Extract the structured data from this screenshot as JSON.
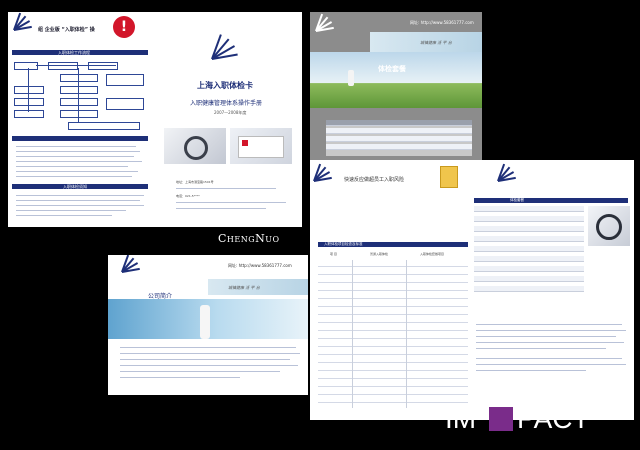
{
  "brand": {
    "designer_signature": "ChengNuo",
    "impact_logo": {
      "left": "IM",
      "right": "PACT"
    }
  },
  "panel_top_left": {
    "heading": "组 企业版 “入职体检” 操 ",
    "section_title": "入职体检工作流程",
    "footer_title": "入职体检须知"
  },
  "panel_top_center": {
    "card_title": "上海入职体检卡",
    "subtitle": "入职健康管理体系操作手册",
    "years": "2007—2008年度",
    "address": "地址：上海市漕宝路1501号",
    "phone": "电话：021-5****"
  },
  "panel_top_right": {
    "website": "网址: http://www.58361777.com",
    "section_title": "体检套餐",
    "banner_text": "城镇健康 活 平 台 "
  },
  "panel_mid_right": {
    "title": "快速反应做超员工入职风险",
    "table_title": "入职体检项目检查及标准",
    "table_title_right": "体检套餐",
    "col_headers": [
      "项 目",
      "普通入职体检",
      "入职体检套餐项目"
    ]
  },
  "panel_bottom_left": {
    "website": "网址: http://www.58361777.com",
    "banner_text": "城镇健康 活 平 台 ",
    "intro_title": "公司简介"
  },
  "icons": {
    "logo": "sun-rays-logo-icon",
    "warning": "exclamation-icon",
    "stethoscope": "stethoscope-icon"
  },
  "colors": {
    "navy": "#1e2f78",
    "red": "#d2162a",
    "purple": "#7a2c8a"
  }
}
